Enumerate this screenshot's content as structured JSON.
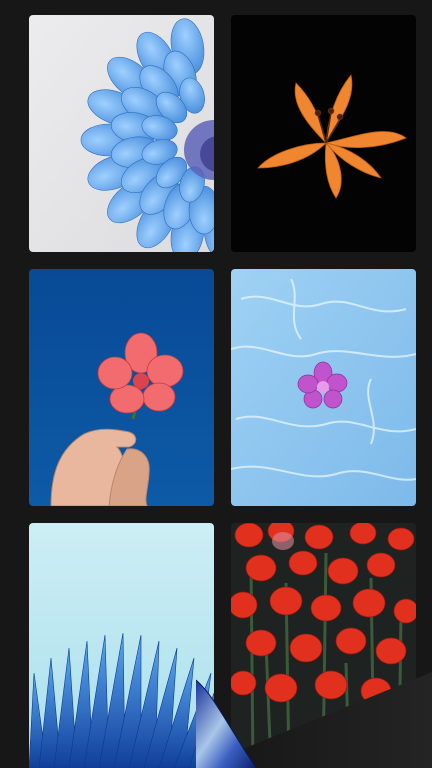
{
  "gallery": {
    "wallpapers": [
      {
        "name": "blue-dahlia",
        "background": "#e7e7e9",
        "accent": "#5b9ee6"
      },
      {
        "name": "orange-lily",
        "background": "#030303",
        "accent": "#f08a34"
      },
      {
        "name": "red-flower-in-hand",
        "background": "#0b4f99",
        "accent": "#f06a6e"
      },
      {
        "name": "pink-flower-on-water",
        "background": "#8fc6ee",
        "accent": "#c04fc8"
      },
      {
        "name": "blue-petals",
        "background": "#bfe9f2",
        "accent": "#1f62c4"
      },
      {
        "name": "red-tulips",
        "background": "#1c1f1e",
        "accent": "#e03020"
      }
    ]
  }
}
